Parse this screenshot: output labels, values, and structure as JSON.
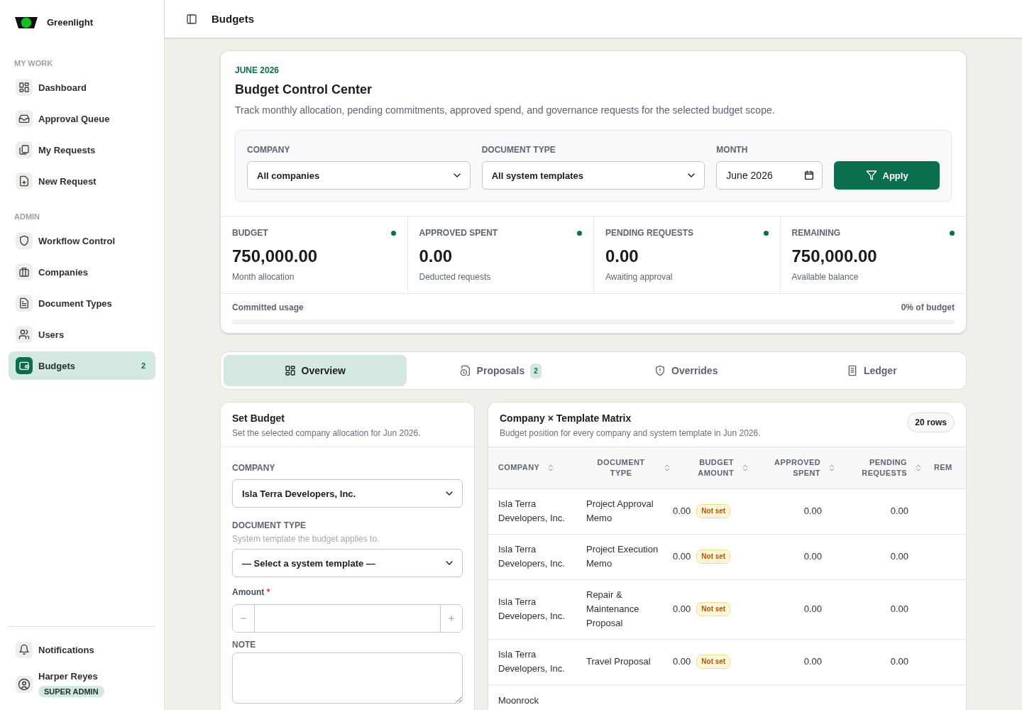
{
  "brand": {
    "name": "Greenlight"
  },
  "nav_sections": [
    {
      "label": "MY WORK",
      "items": [
        {
          "label": "Dashboard",
          "selected": false
        },
        {
          "label": "Approval Queue",
          "selected": false
        },
        {
          "label": "My Requests",
          "selected": false
        },
        {
          "label": "New Request",
          "selected": false
        }
      ]
    },
    {
      "label": "ADMIN",
      "items": [
        {
          "label": "Workflow Control",
          "selected": false
        },
        {
          "label": "Companies",
          "selected": false
        },
        {
          "label": "Document Types",
          "selected": false
        },
        {
          "label": "Users",
          "selected": false
        },
        {
          "label": "Budgets",
          "selected": true,
          "badge": "2"
        }
      ]
    }
  ],
  "sidebar_footer": {
    "notifications": "Notifications",
    "user": {
      "name": "Harper Reyes",
      "role": "SUPER ADMIN"
    }
  },
  "topbar": {
    "title": "Budgets"
  },
  "hero": {
    "eyebrow": "JUNE 2026",
    "title": "Budget Control Center",
    "description": "Track monthly allocation, pending commitments, approved spend, and governance requests for the selected budget scope.",
    "filters": [
      {
        "kind": "select",
        "label": "COMPANY",
        "value": "All companies"
      },
      {
        "kind": "select",
        "label": "DOCUMENT TYPE",
        "value": "All system templates"
      },
      {
        "kind": "month",
        "label": "MONTH",
        "value": "June 2026"
      }
    ],
    "apply": "Apply"
  },
  "stats": [
    {
      "label": "BUDGET",
      "value": "750,000.00",
      "caption": "Month allocation"
    },
    {
      "label": "APPROVED SPENT",
      "value": "0.00",
      "caption": "Deducted requests"
    },
    {
      "label": "PENDING REQUESTS",
      "value": "0.00",
      "caption": "Awaiting approval"
    },
    {
      "label": "REMAINING",
      "value": "750,000.00",
      "caption": "Available balance"
    }
  ],
  "usage": {
    "label": "Committed usage",
    "reading": "0% of budget",
    "level": 0
  },
  "tabs": [
    {
      "label": "Overview",
      "selected": true
    },
    {
      "label": "Proposals",
      "selected": false,
      "badge": "2"
    },
    {
      "label": "Overrides",
      "selected": false
    },
    {
      "label": "Ledger",
      "selected": false
    }
  ],
  "set_budget": {
    "title": "Set Budget",
    "subtitle": "Set the selected company allocation for Jun 2026.",
    "company": {
      "label": "COMPANY",
      "value": "Isla Terra Developers, Inc."
    },
    "document_type": {
      "label": "DOCUMENT TYPE",
      "hint": "System template the budget applies to.",
      "value": "— Select a system template —"
    },
    "amount": {
      "label": "Amount",
      "required_mark": "*"
    },
    "note": {
      "label": "NOTE"
    }
  },
  "matrix": {
    "title": "Company × Template Matrix",
    "subtitle": "Budget position for every company and system template in Jun 2026.",
    "count": "20 rows",
    "columns": [
      {
        "label": "COMPANY"
      },
      {
        "label": "DOCUMENT TYPE"
      },
      {
        "label": "BUDGET AMOUNT"
      },
      {
        "label": "APPROVED SPENT"
      },
      {
        "label": "PENDING REQUESTS"
      },
      {
        "label": "REM"
      }
    ],
    "rows": [
      {
        "company": "Isla Terra Developers, Inc.",
        "document_type": "Project Approval Memo",
        "budget_amount": "0.00",
        "status": "Not set",
        "approved_spent": "0.00",
        "pending_requests": "0.00"
      },
      {
        "company": "Isla Terra Developers, Inc.",
        "document_type": "Project Execution Memo",
        "budget_amount": "0.00",
        "status": "Not set",
        "approved_spent": "0.00",
        "pending_requests": "0.00"
      },
      {
        "company": "Isla Terra Developers, Inc.",
        "document_type": "Repair & Maintenance Proposal",
        "budget_amount": "0.00",
        "status": "Not set",
        "approved_spent": "0.00",
        "pending_requests": "0.00"
      },
      {
        "company": "Isla Terra Developers, Inc.",
        "document_type": "Travel Proposal",
        "budget_amount": "0.00",
        "status": "Not set",
        "approved_spent": "0.00",
        "pending_requests": "0.00"
      },
      {
        "company": "Moonrock"
      }
    ]
  }
}
